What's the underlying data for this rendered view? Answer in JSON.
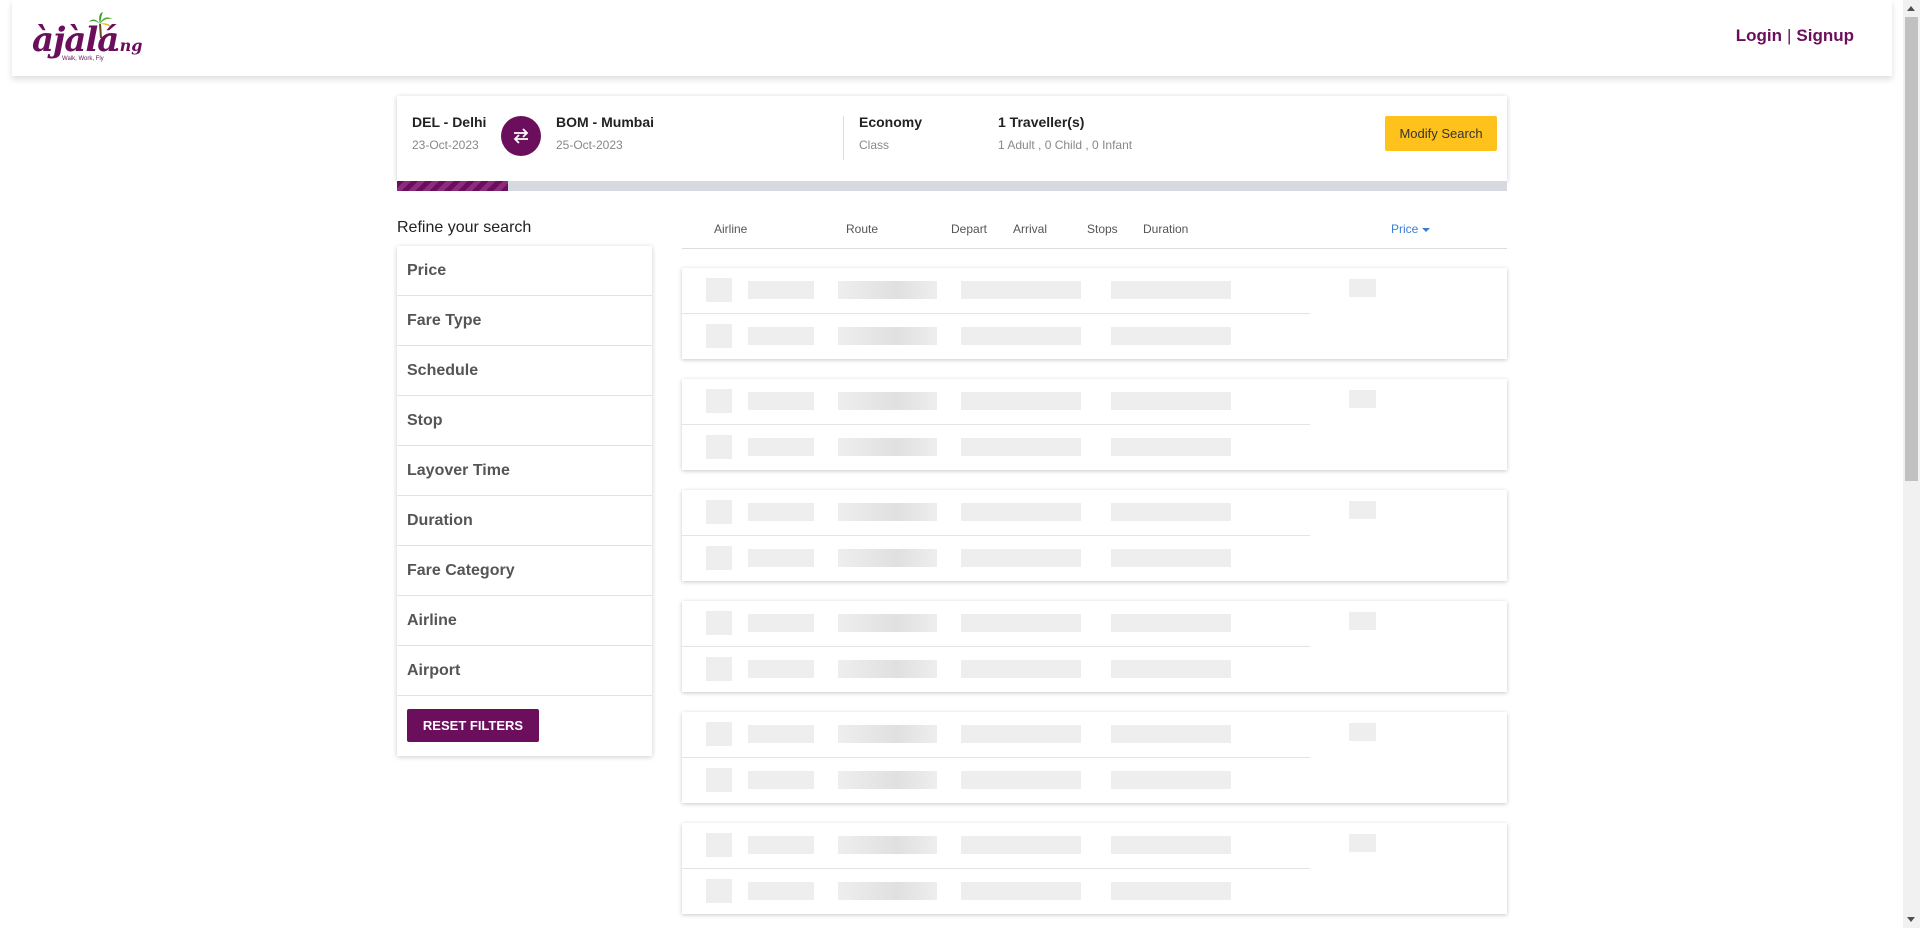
{
  "header": {
    "logo_text": "àjàlá",
    "logo_suffix": ".ng",
    "logo_tagline": "Walk, Work, Fly",
    "login_label": "Login",
    "separator": "|",
    "signup_label": "Signup",
    "brand_color": "#6b0f5c"
  },
  "search": {
    "origin": {
      "code_name": "DEL - Delhi",
      "date": "23-Oct-2023"
    },
    "destination": {
      "code_name": "BOM - Mumbai",
      "date": "25-Oct-2023"
    },
    "swap_icon": "swap-arrows-icon",
    "cabin": {
      "value": "Economy",
      "label": "Class"
    },
    "travellers": {
      "value": "1 Traveller(s)",
      "detail": "1 Adult , 0 Child , 0 Infant"
    },
    "modify_label": "Modify Search",
    "modify_color": "#ffc21c",
    "progress_fraction": 0.1
  },
  "filters": {
    "title": "Refine your search",
    "items": [
      "Price",
      "Fare Type",
      "Schedule",
      "Stop",
      "Layover Time",
      "Duration",
      "Fare Category",
      "Airline",
      "Airport"
    ],
    "reset_label": "RESET FILTERS"
  },
  "results": {
    "columns": {
      "airline": "Airline",
      "route": "Route",
      "depart": "Depart",
      "arrival": "Arrival",
      "stops": "Stops",
      "duration": "Duration",
      "price": "Price"
    },
    "sort_active": "price",
    "skeleton_count": 6
  }
}
